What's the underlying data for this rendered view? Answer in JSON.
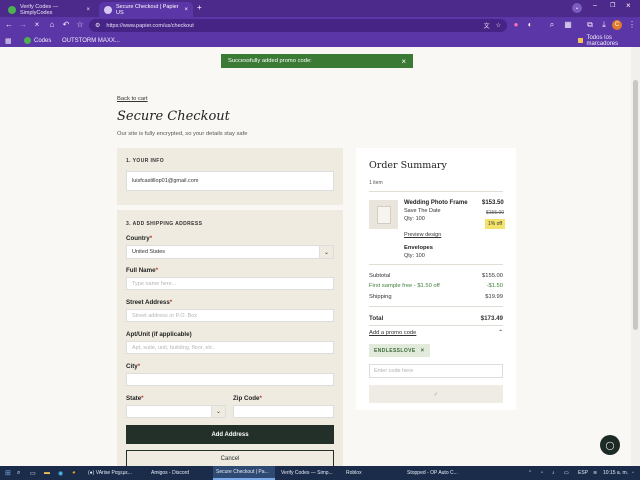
{
  "browser": {
    "tabs": [
      {
        "title": "Verify Codes — SimplyCodes",
        "icon_color": "#4caf50",
        "active": false
      },
      {
        "title": "Secure Checkout | Papier US",
        "icon_color": "#d6c7f3",
        "active": true
      }
    ],
    "new_tab_symbol": "+",
    "url": "https://www.papier.com/us/checkout",
    "bookmarks": [
      {
        "label": "Codes",
        "icon": "codes-icon"
      },
      {
        "label": "OUTSTORM MAXX..."
      }
    ],
    "all_bookmarks_label": "Todos los marcadores",
    "profile_initial": "C"
  },
  "toast": {
    "message": "Successfully added promo code:",
    "close_symbol": "×"
  },
  "checkout": {
    "back_link": "Back to cart",
    "title": "Secure Checkout",
    "subtitle": "Our site is fully encrypted, so your details stay safe",
    "your_info": {
      "heading": "1. YOUR INFO",
      "email": "luisfcastillop01@gmail.com"
    },
    "shipping": {
      "heading": "3. ADD SHIPPING ADDRESS",
      "country_label": "Country",
      "country_value": "United States",
      "full_name_label": "Full Name",
      "full_name_placeholder": "Type name here...",
      "street_label": "Street Address",
      "street_placeholder": "Street address or P.O. Box",
      "apt_label": "Apt/Unit (if applicable)",
      "apt_placeholder": "Apt, suite, unit, building, floor, etc.",
      "city_label": "City",
      "state_label": "State",
      "zip_label": "Zip Code",
      "required_mark": "*",
      "add_address_button": "Add Address",
      "cancel_button": "Cancel"
    }
  },
  "order_summary": {
    "title": "Order Summary",
    "item_count": "1 item",
    "item": {
      "name": "Wedding Photo Frame",
      "subtitle": "Save The Date",
      "qty": "Qty: 100",
      "price": "$153.50",
      "original_price": "$155.00",
      "discount_badge": "1% off",
      "preview_link": "Preview design",
      "addon_name": "Envelopes",
      "addon_qty": "Qty: 100"
    },
    "subtotal_label": "Subtotal",
    "subtotal_value": "$155.00",
    "discount_label": "First sample free - $1.50 off",
    "discount_value": "-$1.50",
    "shipping_label": "Shipping",
    "shipping_value": "$19.99",
    "total_label": "Total",
    "total_value": "$173.49",
    "promo_link": "Add a promo code",
    "promo_chip": "ENDLESSLOVE",
    "promo_chip_remove": "×",
    "promo_placeholder": "Enter code here",
    "apply_symbol": "✓"
  },
  "taskbar": {
    "items": [
      {
        "label": "(●) VArise Ραχεμε...",
        "active": false
      },
      {
        "label": "Amigos - Discord",
        "active": false
      },
      {
        "label": "Secure Checkout | Pa...",
        "active": true
      },
      {
        "label": "Verify Codes — Simp...",
        "active": false
      },
      {
        "label": "Roblox",
        "active": false
      },
      {
        "label": "Stopped - OP Auto C...",
        "active": false
      }
    ],
    "language": "ESP",
    "time": "10:15 a. m."
  },
  "colors": {
    "browser_frame": "#5b36a6",
    "toast_green": "#3a7a35",
    "primary_button": "#233029",
    "panel_bg": "#f0ebe1",
    "discount_badge": "#f3e36c"
  }
}
